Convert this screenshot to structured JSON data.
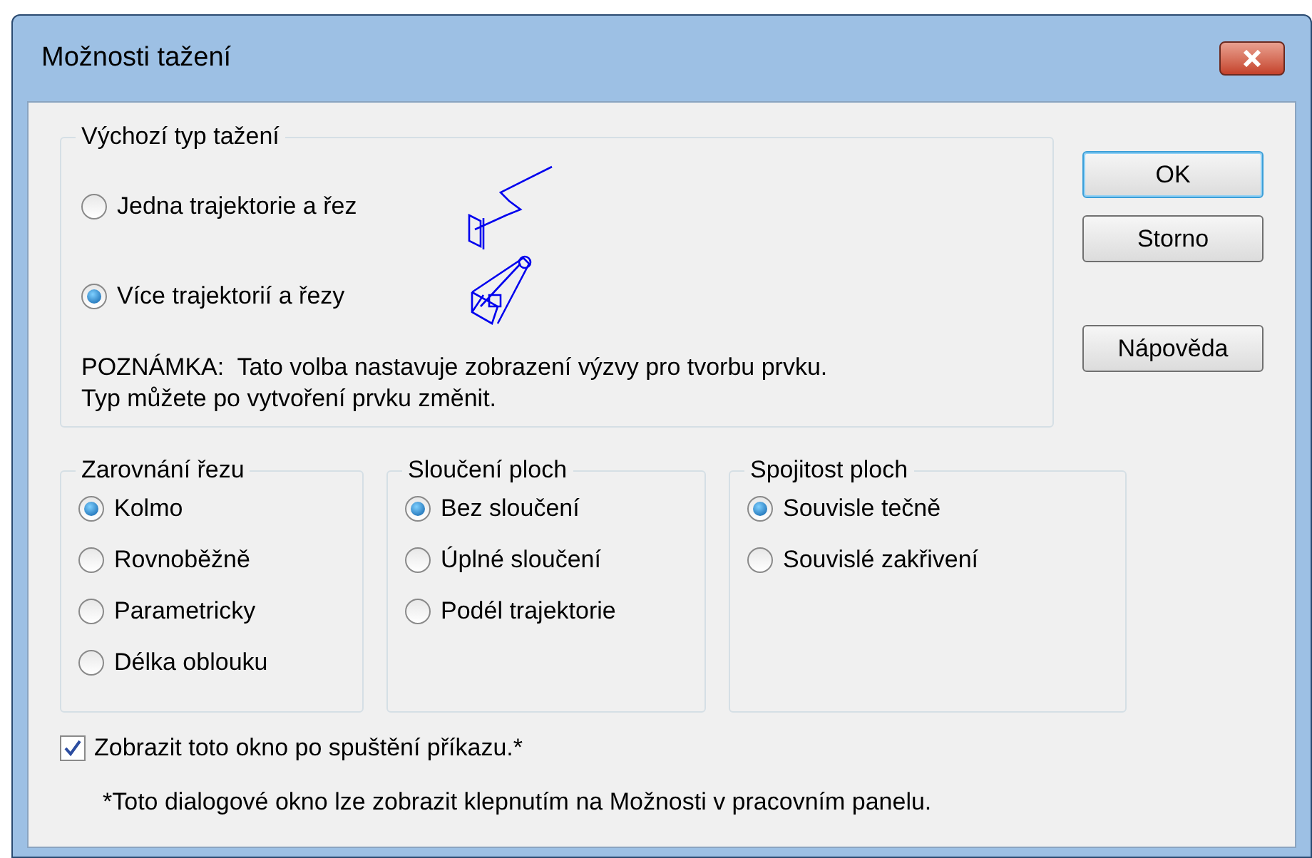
{
  "window": {
    "title": "Možnosti tažení"
  },
  "sweep_type": {
    "title": "Výchozí typ tažení",
    "options": [
      {
        "label": "Jedna trajektorie a řez",
        "selected": false
      },
      {
        "label": "Více trajektorií a řezy",
        "selected": true
      }
    ],
    "note": [
      "POZNÁMKA:  Tato volba nastavuje zobrazení výzvy pro tvorbu prvku.",
      "Typ můžete po vytvoření prvku změnit."
    ]
  },
  "buttons": [
    {
      "label": "OK",
      "default": true
    },
    {
      "label": "Storno",
      "default": false
    },
    {
      "label": "Nápověda",
      "default": false
    }
  ],
  "groups": [
    {
      "title": "Zarovnání řezu",
      "options": [
        {
          "label": "Kolmo",
          "selected": true
        },
        {
          "label": "Rovnoběžně",
          "selected": false
        },
        {
          "label": "Parametricky",
          "selected": false
        },
        {
          "label": "Délka oblouku",
          "selected": false
        }
      ]
    },
    {
      "title": "Sloučení ploch",
      "options": [
        {
          "label": "Bez sloučení",
          "selected": true
        },
        {
          "label": "Úplné sloučení",
          "selected": false
        },
        {
          "label": "Podél trajektorie",
          "selected": false
        }
      ]
    },
    {
      "title": "Spojitost ploch",
      "options": [
        {
          "label": "Souvisle tečně",
          "selected": true
        },
        {
          "label": "Souvislé zakřivení",
          "selected": false
        }
      ]
    }
  ],
  "show_dialog": {
    "label": "Zobrazit toto okno po spuštění příkazu.*",
    "checked": true
  },
  "footnote": "*Toto dialogové okno lze zobrazit klepnutím na Možnosti v pracovním panelu."
}
